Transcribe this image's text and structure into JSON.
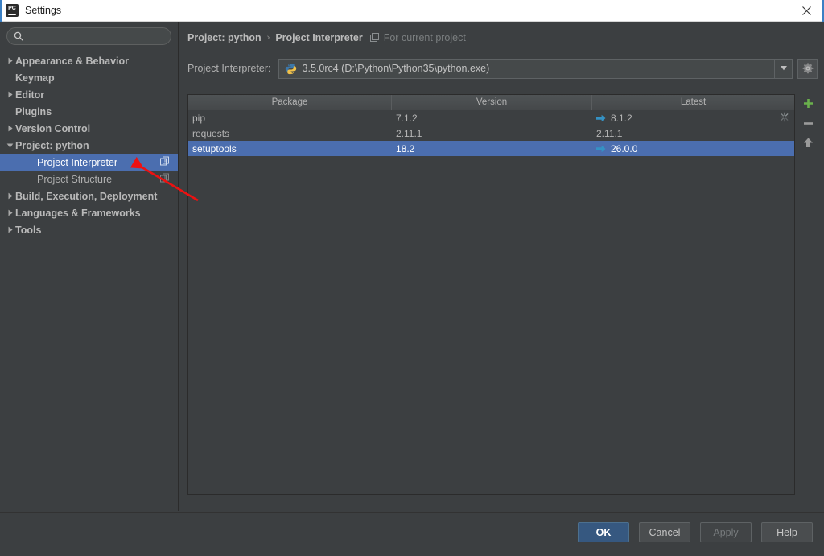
{
  "window": {
    "title": "Settings",
    "app_icon": "pycharm-logo-icon",
    "close_label": "close-icon"
  },
  "sidebar": {
    "search": {
      "value": "",
      "placeholder": "",
      "icon": "search-icon"
    },
    "items": [
      {
        "label": "Appearance & Behavior",
        "level": 0,
        "arrow": "collapsed",
        "bold": true,
        "selected": false,
        "copy_icon": false
      },
      {
        "label": "Keymap",
        "level": 0,
        "arrow": "none",
        "bold": true,
        "selected": false,
        "copy_icon": false
      },
      {
        "label": "Editor",
        "level": 0,
        "arrow": "collapsed",
        "bold": true,
        "selected": false,
        "copy_icon": false
      },
      {
        "label": "Plugins",
        "level": 0,
        "arrow": "none",
        "bold": true,
        "selected": false,
        "copy_icon": false
      },
      {
        "label": "Version Control",
        "level": 0,
        "arrow": "collapsed",
        "bold": true,
        "selected": false,
        "copy_icon": false
      },
      {
        "label": "Project: python",
        "level": 0,
        "arrow": "expanded",
        "bold": true,
        "selected": false,
        "copy_icon": false
      },
      {
        "label": "Project Interpreter",
        "level": 1,
        "arrow": "none",
        "bold": false,
        "selected": true,
        "copy_icon": true
      },
      {
        "label": "Project Structure",
        "level": 1,
        "arrow": "none",
        "bold": false,
        "selected": false,
        "copy_icon": true
      },
      {
        "label": "Build, Execution, Deployment",
        "level": 0,
        "arrow": "collapsed",
        "bold": true,
        "selected": false,
        "copy_icon": false
      },
      {
        "label": "Languages & Frameworks",
        "level": 0,
        "arrow": "collapsed",
        "bold": true,
        "selected": false,
        "copy_icon": false
      },
      {
        "label": "Tools",
        "level": 0,
        "arrow": "collapsed",
        "bold": true,
        "selected": false,
        "copy_icon": false
      }
    ]
  },
  "breadcrumb": {
    "root": "Project: python",
    "separator": "›",
    "current": "Project Interpreter",
    "scope_icon": "project-scope-icon",
    "scope_note": "For current project"
  },
  "interpreter": {
    "label": "Project Interpreter:",
    "icon": "python-logo-icon",
    "value": "3.5.0rc4 (D:\\Python\\Python35\\python.exe)",
    "dropdown_icon": "chevron-down-icon",
    "settings_icon": "gear-icon"
  },
  "packages": {
    "columns": [
      "Package",
      "Version",
      "Latest"
    ],
    "rows": [
      {
        "package": "pip",
        "version": "7.1.2",
        "latest": "8.1.2",
        "upgradable": true,
        "selected": false,
        "loading": true
      },
      {
        "package": "requests",
        "version": "2.11.1",
        "latest": "2.11.1",
        "upgradable": false,
        "selected": false,
        "loading": false
      },
      {
        "package": "setuptools",
        "version": "18.2",
        "latest": "26.0.0",
        "upgradable": true,
        "selected": true,
        "loading": false
      }
    ],
    "toolbar": [
      {
        "name": "add-package-button",
        "icon": "plus-icon",
        "color": "#6ab04c"
      },
      {
        "name": "remove-package-button",
        "icon": "minus-icon",
        "color": "#9a9a9a"
      },
      {
        "name": "upgrade-package-button",
        "icon": "up-arrow-icon",
        "color": "#9a9a9a"
      }
    ]
  },
  "footer": {
    "ok": "OK",
    "cancel": "Cancel",
    "apply": "Apply",
    "help": "Help"
  },
  "annotation": {
    "type": "red-arrow",
    "color": "#ee1111"
  },
  "colors": {
    "selection_blue": "#4b6eaf",
    "primary_button": "#365880",
    "upgrade_arrow": "#3592c4",
    "add_green": "#6ab04c",
    "background": "#3c3f41"
  }
}
